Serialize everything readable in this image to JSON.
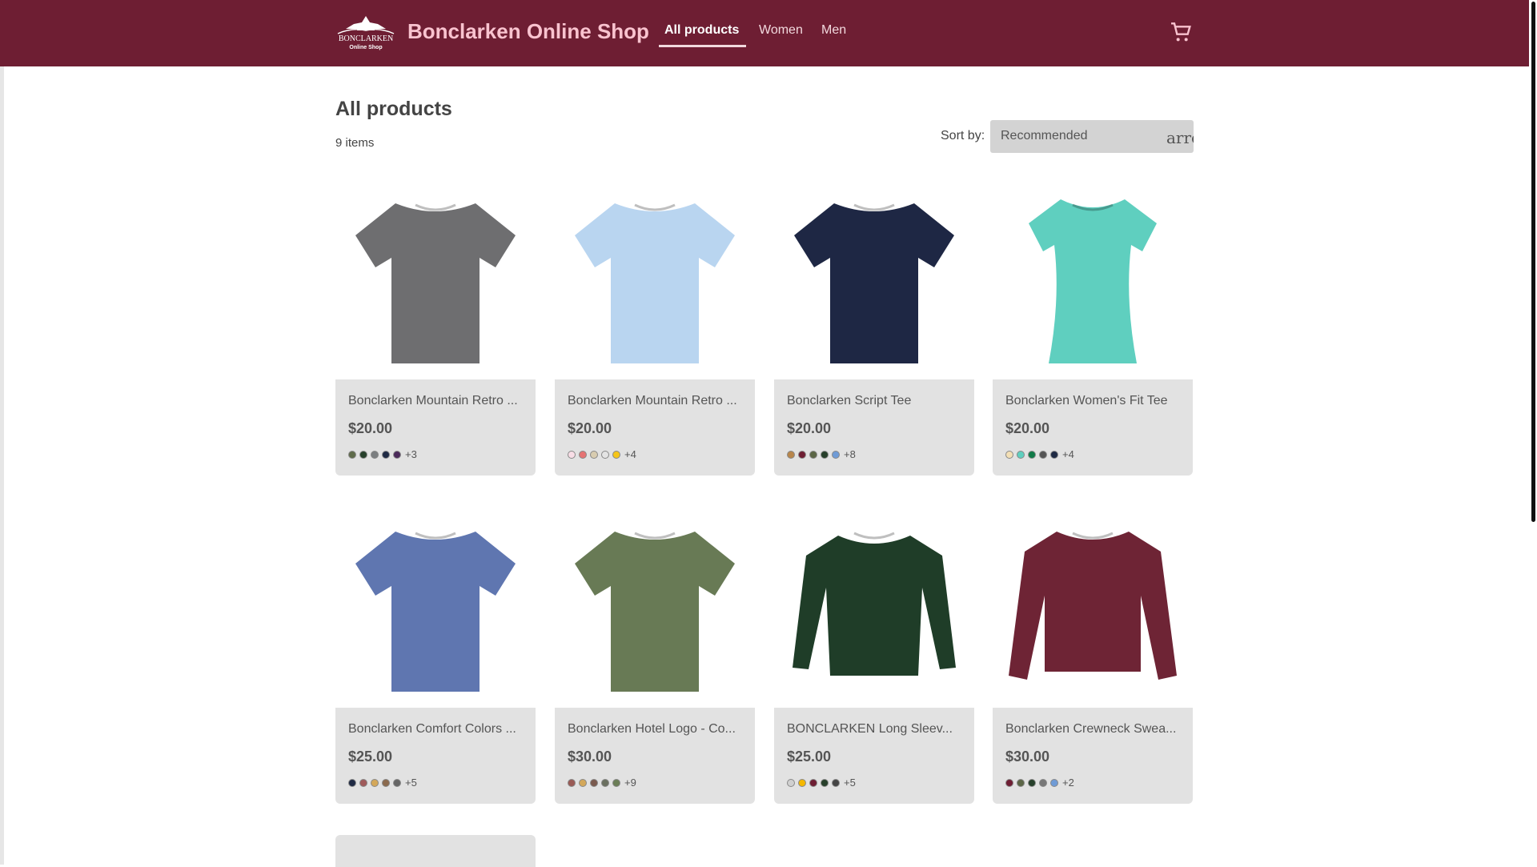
{
  "header": {
    "title": "Bonclarken Online Shop",
    "logo_text": "BONCLARKEN Online Shop",
    "nav": [
      "All products",
      "Women",
      "Men"
    ],
    "brand_color": "#6e1e33"
  },
  "page": {
    "title": "All products",
    "count": "9 items",
    "sort_label": "Sort by:",
    "sort_value": "Recommended",
    "sort_arrow_text": "arrow_drop_down"
  },
  "products": [
    {
      "name": "Bonclarken Mountain Retro ...",
      "price": "$20.00",
      "more": "+3",
      "color": "#6e6e70",
      "swatches": [
        "#5f6b4a",
        "#27402b",
        "#7b7e80",
        "#1f2a44",
        "#4b2a5a"
      ]
    },
    {
      "name": "Bonclarken Mountain Retro ...",
      "price": "$20.00",
      "more": "+4",
      "color": "#b9d5f0",
      "swatches": [
        "#f8dde6",
        "#e57373",
        "#d8ccb0",
        "#e4e4e4",
        "#f5c518"
      ]
    },
    {
      "name": "Bonclarken Script Tee",
      "price": "$20.00",
      "more": "+8",
      "color": "#1e2744",
      "swatches": [
        "#b8864b",
        "#6e1e33",
        "#5c6646",
        "#27402b",
        "#6f9bd6"
      ]
    },
    {
      "name": "Bonclarken Women's Fit Tee",
      "price": "$20.00",
      "more": "+4",
      "color": "#5fcfbf",
      "swatches": [
        "#f3dfb5",
        "#5fcfbf",
        "#117a48",
        "#555555",
        "#1f2a44"
      ]
    },
    {
      "name": "Bonclarken Comfort Colors ...",
      "price": "$25.00",
      "more": "+5",
      "color": "#5f76b0",
      "swatches": [
        "#1f2a44",
        "#a05a5a",
        "#d4a85a",
        "#8b6a4e",
        "#666666"
      ]
    },
    {
      "name": "Bonclarken Hotel Logo - Co...",
      "price": "$30.00",
      "more": "+9",
      "color": "#687a55",
      "swatches": [
        "#9a5a55",
        "#d4a85a",
        "#7a5a4e",
        "#6b7060",
        "#6b7e57"
      ]
    },
    {
      "name": "BONCLARKEN Long Sleev...",
      "price": "$25.00",
      "more": "+5",
      "color": "#1f3d28",
      "swatches": [
        "#d0d0d0",
        "#f5b800",
        "#6e1e33",
        "#27402b",
        "#444444"
      ]
    },
    {
      "name": "Bonclarken Crewneck Swea...",
      "price": "$30.00",
      "more": "+2",
      "color": "#6e2435",
      "swatches": [
        "#6e1e33",
        "#5c6646",
        "#27402b",
        "#777777",
        "#6f9bd6"
      ]
    }
  ]
}
